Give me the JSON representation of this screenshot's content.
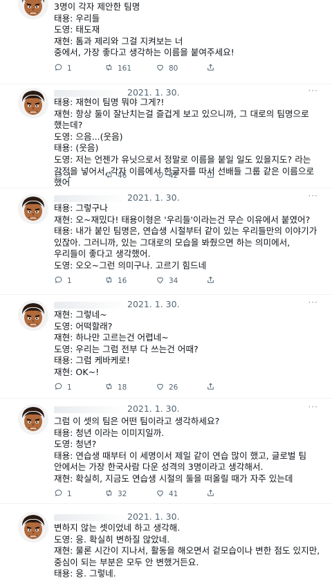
{
  "tweets": [
    {
      "date": "",
      "lines": [
        "3명이 각자 제안한 팀명",
        "태용: 우리들",
        "도영: 태도재",
        "재현: 톰과 제리와 그걸 지켜보는 너",
        "중에서, 가장 좋다고 생각하는 이름을 붙여주세요!"
      ],
      "replies": "1",
      "retweets": "161",
      "likes": "80"
    },
    {
      "date": "2021. 1. 30.",
      "lines": [
        "태용: 재현이 팀명 뭐야 그게?!",
        "재현: 항상 둘이 잘난치는걸 즐겁게 보고 있으니까, 그 대로의 팀명으로 했는데?",
        "도영: 으음...(웃음)",
        "태용: (웃음)",
        "도영: 저는 언젠가 유닛으로서 정말로 이름을 붙일 일도 있을지도? 라는 감정을 넣어서, 각자 이름에서 한글자를 따서 선배들 그룹 같은 이름으로 했어"
      ],
      "replies": "1",
      "retweets": "46",
      "likes": "42"
    },
    {
      "date": "2021. 1. 30.",
      "lines": [
        "태용: 그렇구나",
        "재현: 오~재밌다! 태용이형은 '우리들'이라는건 무슨 이유에서 붙였어?",
        "태용: 내가 붙인 팀명은, 연습생 시절부터 같이 있는 우리들만의 이야기가 있잖아. 그러니까, 있는 그대로의 모습을 봐줬으면 하는 의미에서, 우리들이 좋다고 생각했어.",
        "도영: 오오~그런 의미구나. 고르기 힘드네"
      ],
      "replies": "1",
      "retweets": "16",
      "likes": "34"
    },
    {
      "date": "2021. 1. 30.",
      "lines": [
        "재현: 그렇네~",
        "도영: 어떡할래?",
        "재현: 하나만 고르는건 어렵네~",
        "도영: 우리는 그럼 전부 다 쓰는건 어때?",
        "태용: 그럼 케바케로!",
        "재현: OK~!"
      ],
      "replies": "1",
      "retweets": "18",
      "likes": "26"
    },
    {
      "date": "2021. 1. 30.",
      "lines": [
        "그럼 이 셋의 팀은 어떤 팀이라고 생각하세요?",
        "태용: 청년 이라는 이미지일까.",
        "도영: 청년?",
        "태용: 연습생 때부터 이 세명이서 제일 같이 연습 많이 했고, 글로벌 팀 안에서는 가장 한국사람 다운 성격의 3명이라고 생각해서.",
        "재현: 확실히, 지금도 연습생 시절의 둘을 떠올릴 때가 자주 있는데"
      ],
      "replies": "1",
      "retweets": "32",
      "likes": "41"
    },
    {
      "date": "2021. 1. 30.",
      "lines": [
        "변하지 않는 셋이었네 하고 생각해.",
        "도영: 응. 확실히 변하질 않았네.",
        "재현: 물론 시간이 지나서, 활동을 해오면서 겉모습이나 변한 점도 있지만, 중심이 되는 부분은 모두 안 변했거든요.",
        "태용: 응. 그렇네."
      ],
      "replies": "",
      "retweets": "",
      "likes": ""
    }
  ],
  "colors": {
    "text": "#0f1419",
    "muted": "#536471",
    "divider": "#eff3f4"
  },
  "icons": {
    "reply": "reply-icon",
    "retweet": "retweet-icon",
    "like": "heart-icon",
    "more": "more-icon"
  }
}
